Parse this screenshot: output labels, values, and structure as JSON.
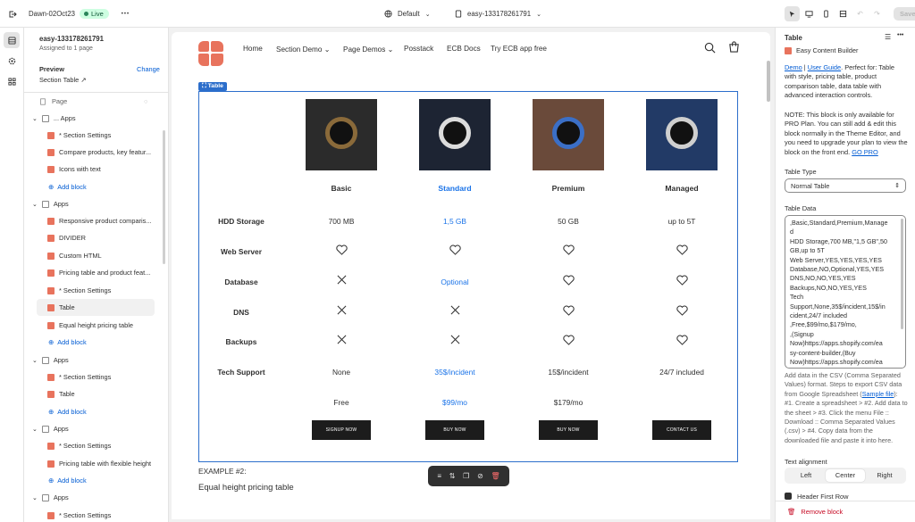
{
  "topbar": {
    "store_name": "Dawn-02Oct23",
    "live_label": "Live",
    "more": "•••",
    "theme_select": "Default",
    "template_select": "easy-133178261791",
    "save_label": "Save"
  },
  "sidebar": {
    "template_title": "easy-133178261791",
    "assigned": "Assigned to 1 page",
    "preview_label": "Preview",
    "change_label": "Change",
    "preview_value": "Section Table",
    "page_label": "Page",
    "items": [
      {
        "label": "... Apps",
        "kind": "group"
      },
      {
        "label": "* Section Settings",
        "kind": "block"
      },
      {
        "label": "Compare products, key featur...",
        "kind": "block"
      },
      {
        "label": "Icons with text",
        "kind": "block"
      },
      {
        "label": "Add block",
        "kind": "add"
      },
      {
        "label": "Apps",
        "kind": "group"
      },
      {
        "label": "Responsive product comparis...",
        "kind": "block"
      },
      {
        "label": "DIVIDER",
        "kind": "block"
      },
      {
        "label": "Custom HTML",
        "kind": "block"
      },
      {
        "label": "Pricing table and product feat...",
        "kind": "block"
      },
      {
        "label": "* Section Settings",
        "kind": "block"
      },
      {
        "label": "Table",
        "kind": "block",
        "selected": true
      },
      {
        "label": "Equal height pricing table",
        "kind": "block"
      },
      {
        "label": "Add block",
        "kind": "add"
      },
      {
        "label": "Apps",
        "kind": "group"
      },
      {
        "label": "* Section Settings",
        "kind": "block"
      },
      {
        "label": "Table",
        "kind": "block"
      },
      {
        "label": "Add block",
        "kind": "add"
      },
      {
        "label": "Apps",
        "kind": "group"
      },
      {
        "label": "* Section Settings",
        "kind": "block"
      },
      {
        "label": "Pricing table with flexible height",
        "kind": "block"
      },
      {
        "label": "Add block",
        "kind": "add"
      },
      {
        "label": "Apps",
        "kind": "group"
      },
      {
        "label": "* Section Settings",
        "kind": "block"
      }
    ]
  },
  "store": {
    "nav": [
      "Home",
      "Section Demo",
      "Page Demos",
      "Posstack",
      "ECB Docs",
      "Try ECB app free"
    ],
    "table_tag": "Table",
    "plans": [
      "Basic",
      "Standard",
      "Premium",
      "Managed"
    ],
    "rows": [
      {
        "label": "HDD Storage",
        "values": [
          "700 MB",
          "1,5 GB",
          "50 GB",
          "up to 5T"
        ]
      },
      {
        "label": "Web Server",
        "values": [
          "heart",
          "heart",
          "heart",
          "heart"
        ]
      },
      {
        "label": "Database",
        "values": [
          "x",
          "Optional",
          "heart",
          "heart"
        ]
      },
      {
        "label": "DNS",
        "values": [
          "x",
          "x",
          "heart",
          "heart"
        ]
      },
      {
        "label": "Backups",
        "values": [
          "x",
          "x",
          "heart",
          "heart"
        ]
      },
      {
        "label": "Tech Support",
        "values": [
          "None",
          "35$/incident",
          "15$/incident",
          "24/7 included"
        ]
      },
      {
        "label": "",
        "values": [
          "Free",
          "$99/mo",
          "$179/mo",
          ""
        ]
      }
    ],
    "buttons": [
      "SIGNUP NOW",
      "BUY NOW",
      "BUY NOW",
      "CONTACT US"
    ],
    "example_label": "EXAMPLE #2:",
    "example_title": "Equal height pricing table",
    "highlight_color": "#1a73e8"
  },
  "panel": {
    "title": "Table",
    "app_name": "Easy Content Builder",
    "demo_link": "Demo",
    "sep": " | ",
    "guide_link": "User Guide",
    "desc": ". Perfect for: Table with style, pricing table, product comparison table, data table with advanced interaction controls.",
    "note": "NOTE: This block is only available for PRO Plan. You can still add & edit this block normally in the Theme Editor, and you need to upgrade your plan to view the block on the front end.",
    "go_pro": "GO PRO",
    "type_label": "Table Type",
    "type_value": "Normal Table",
    "data_label": "Table Data",
    "data_lines": [
      ",Basic,Standard,Premium,Manage",
      "d",
      "HDD Storage,700 MB,\"1,5 GB\",50",
      "GB,up to 5T",
      "Web Server,YES,YES,YES,YES",
      "Database,NO,Optional,YES,YES",
      "DNS,NO,NO,YES,YES",
      "Backups,NO,NO,YES,YES",
      "Tech",
      "Support,None,35$/incident,15$/in",
      "cident,24/7 included",
      ",Free,$99/mo,$179/mo,",
      ",(Signup",
      "Now)https://apps.shopify.com/ea",
      "sy-content-builder,(Buy",
      "Now)https://apps.shopify.com/ea"
    ],
    "help_pre": "Add data in the CSV (Comma Separated Values) format. Steps to export CSV data from Google Spreadsheet (",
    "help_link": "Sample file",
    "help_post": "): #1. Create a spreadsheet > #2. Add data to the sheet > #3. Click the menu File :: Download :: Comma Separated Values (.csv) > #4. Copy data from the downloaded file and paste it into here.",
    "align_label": "Text alignment",
    "align_options": [
      "Left",
      "Center",
      "Right"
    ],
    "header_first_row": "Header First Row",
    "remove_label": "Remove block"
  }
}
